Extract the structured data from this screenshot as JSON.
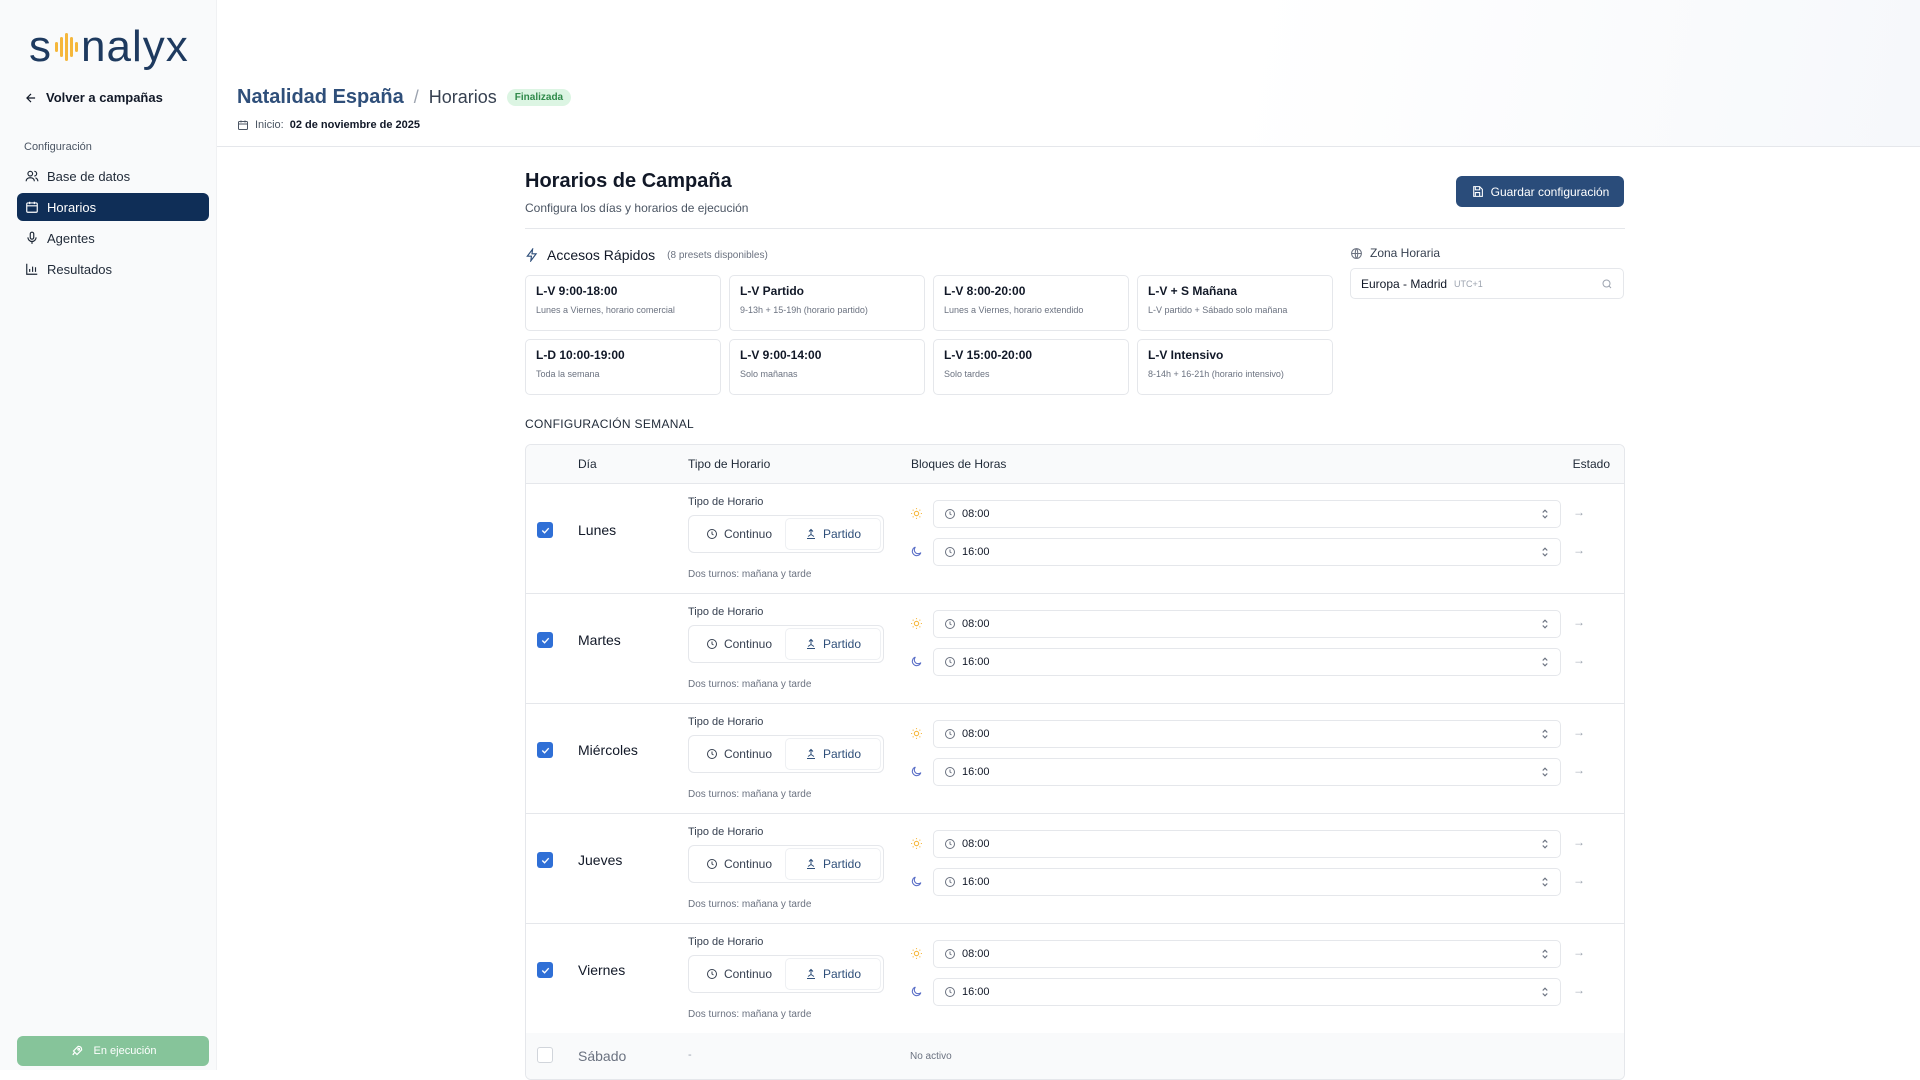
{
  "brand": {
    "logo_pre": "s",
    "logo_post": "nalyx",
    "colors": {
      "navy": "#0f2e57",
      "accent": "#f5b73b",
      "green": "#86c49a"
    }
  },
  "sidebar": {
    "back_label": "Volver a campañas",
    "section_label": "Configuración",
    "items": [
      {
        "label": "Base de datos",
        "icon": "users-icon",
        "active": false
      },
      {
        "label": "Horarios",
        "icon": "calendar-icon",
        "active": true
      },
      {
        "label": "Agentes",
        "icon": "microphone-icon",
        "active": false
      },
      {
        "label": "Resultados",
        "icon": "bar-chart-icon",
        "active": false
      }
    ],
    "status_button": "En ejecución"
  },
  "header": {
    "project": "Natalidad España",
    "separator": "/",
    "section": "Horarios",
    "badge": "Finalizada",
    "start_label": "Inicio:",
    "start_date": "02 de noviembre de 2025"
  },
  "main": {
    "title": "Horarios de Campaña",
    "subtitle": "Configura los días y horarios de ejecución",
    "save_label": "Guardar configuración",
    "quick": {
      "title": "Accesos Rápidos",
      "count": "(8 presets disponibles)",
      "presets": [
        {
          "name": "L-V 9:00-18:00",
          "desc": "Lunes a Viernes, horario comercial"
        },
        {
          "name": "L-V Partido",
          "desc": "9-13h + 15-19h (horario partido)"
        },
        {
          "name": "L-V 8:00-20:00",
          "desc": "Lunes a Viernes, horario extendido"
        },
        {
          "name": "L-V + S Mañana",
          "desc": "L-V partido + Sábado solo mañana"
        },
        {
          "name": "L-D 10:00-19:00",
          "desc": "Toda la semana"
        },
        {
          "name": "L-V 9:00-14:00",
          "desc": "Solo mañanas"
        },
        {
          "name": "L-V 15:00-20:00",
          "desc": "Solo tardes"
        },
        {
          "name": "L-V Intensivo",
          "desc": "8-14h + 16-21h (horario intensivo)"
        }
      ]
    },
    "timezone": {
      "label": "Zona Horaria",
      "value": "Europa - Madrid",
      "offset": "UTC+1"
    },
    "weekly": {
      "title": "CONFIGURACIÓN SEMANAL",
      "columns": {
        "day": "Día",
        "type": "Tipo de Horario",
        "blocks": "Bloques de Horas",
        "status": "Estado"
      },
      "type_label": "Tipo de Horario",
      "opt_continuo": "Continuo",
      "opt_partido": "Partido",
      "type_desc": "Dos turnos: mañana y tarde",
      "days": [
        {
          "name": "Lunes",
          "checked": true,
          "morning": "08:00",
          "afternoon": "16:00"
        },
        {
          "name": "Martes",
          "checked": true,
          "morning": "08:00",
          "afternoon": "16:00"
        },
        {
          "name": "Miércoles",
          "checked": true,
          "morning": "08:00",
          "afternoon": "16:00"
        },
        {
          "name": "Jueves",
          "checked": true,
          "morning": "08:00",
          "afternoon": "16:00"
        },
        {
          "name": "Viernes",
          "checked": true,
          "morning": "08:00",
          "afternoon": "16:00"
        }
      ],
      "inactive_day": {
        "name": "Sábado",
        "type": "-",
        "blocks": "No activo"
      }
    }
  }
}
